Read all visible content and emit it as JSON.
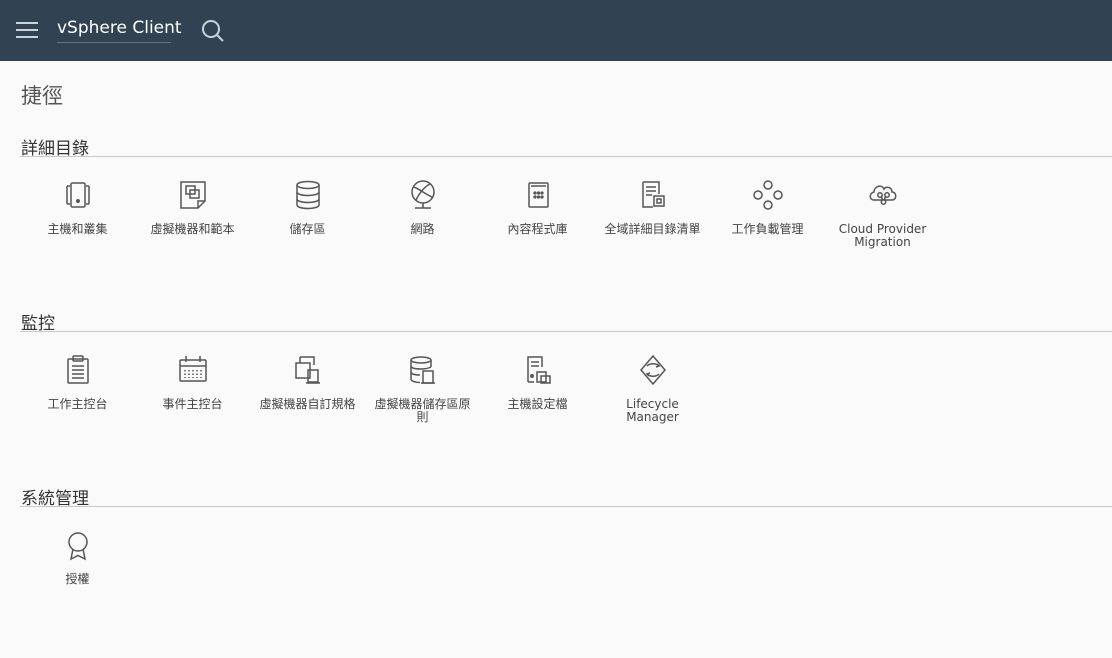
{
  "header": {
    "app_title": "vSphere Client",
    "colors": {
      "background": "#314352",
      "text": "#ffffff"
    }
  },
  "page": {
    "title": "捷徑"
  },
  "sections": [
    {
      "title": "詳細目錄",
      "items": [
        {
          "label": "主機和叢集",
          "icon": "hosts-clusters-icon"
        },
        {
          "label": "虛擬機器和範本",
          "icon": "vms-templates-icon"
        },
        {
          "label": "儲存區",
          "icon": "storage-icon"
        },
        {
          "label": "網路",
          "icon": "network-icon"
        },
        {
          "label": "內容程式庫",
          "icon": "content-library-icon"
        },
        {
          "label": "全域詳細目錄清單",
          "icon": "global-inventory-icon"
        },
        {
          "label": "工作負載管理",
          "icon": "workload-management-icon"
        },
        {
          "label": "Cloud Provider Migration",
          "icon": "cloud-migration-icon"
        }
      ]
    },
    {
      "title": "監控",
      "items": [
        {
          "label": "工作主控台",
          "icon": "task-console-icon"
        },
        {
          "label": "事件主控台",
          "icon": "event-console-icon"
        },
        {
          "label": "虛擬機器自訂規格",
          "icon": "vm-customization-icon"
        },
        {
          "label": "虛擬機器儲存區原則",
          "icon": "vm-storage-policy-icon"
        },
        {
          "label": "主機設定檔",
          "icon": "host-profile-icon"
        },
        {
          "label": "Lifecycle Manager",
          "icon": "lifecycle-manager-icon"
        }
      ]
    },
    {
      "title": "系統管理",
      "items": [
        {
          "label": "授權",
          "icon": "licensing-icon"
        }
      ]
    }
  ]
}
